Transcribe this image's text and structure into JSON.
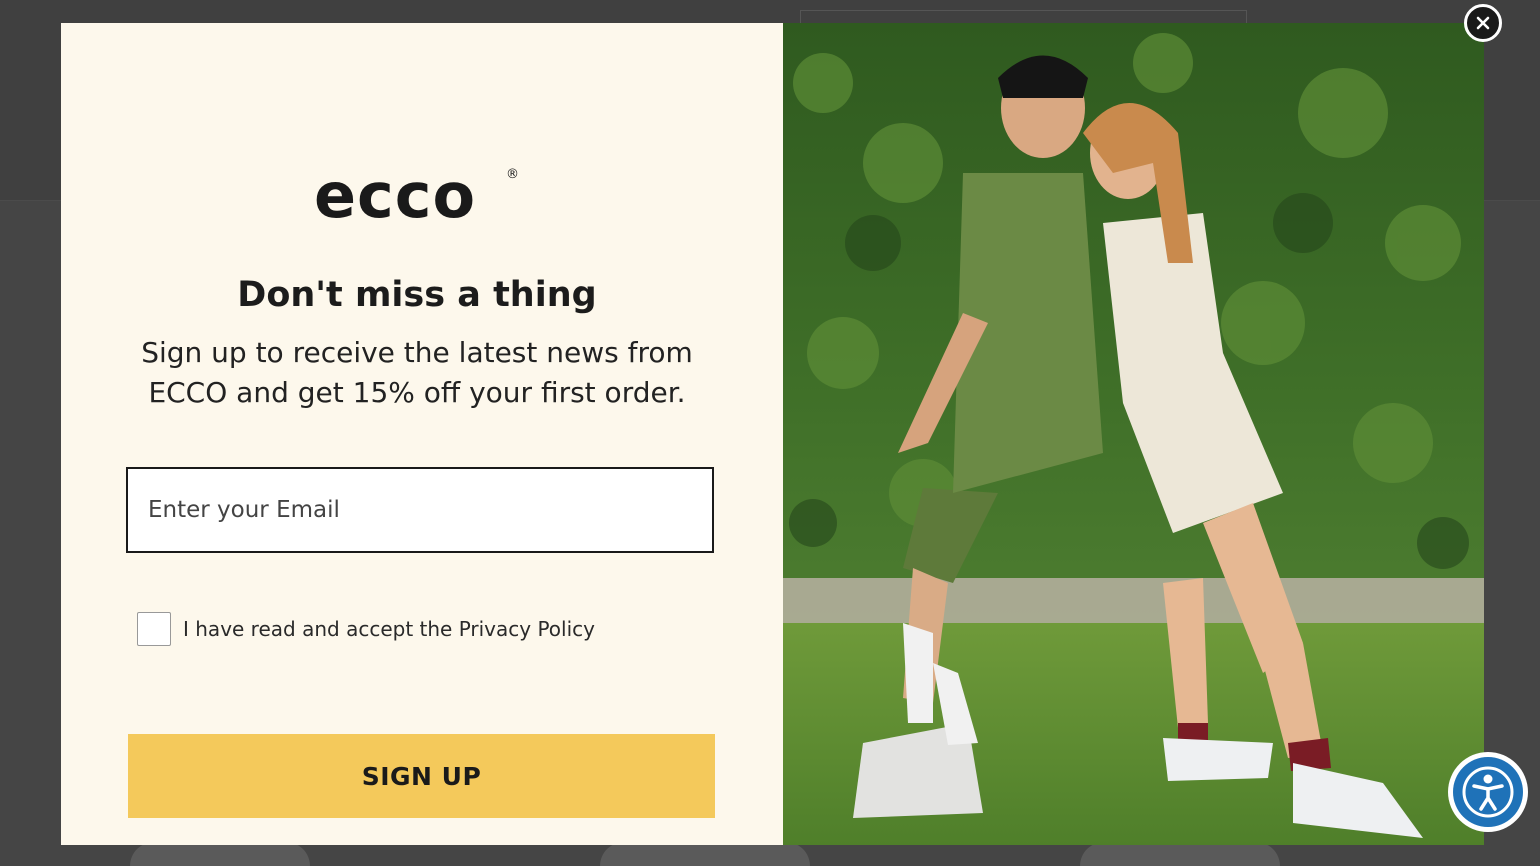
{
  "popup": {
    "logo_text": "ecco",
    "logo_registered": "®",
    "headline": "Don't miss a thing",
    "subtext": "Sign up to receive the latest news from ECCO and get 15% off your first order.",
    "email": {
      "placeholder": "Enter your Email",
      "value": ""
    },
    "privacy_label": "I have read and accept the Privacy Policy",
    "privacy_checked": false,
    "signup_label": "SIGN UP",
    "close_icon": "close-icon",
    "photo_alt": "Two people in summer outfits and ECCO sneakers leaning back to back on a lawn in front of a green hedge"
  },
  "accessibility": {
    "icon": "accessibility-icon"
  },
  "colors": {
    "panel_bg": "#fdf8ec",
    "button_bg": "#f4c95b",
    "overlay": "#454545",
    "accessibility_blue": "#1f72b8"
  }
}
